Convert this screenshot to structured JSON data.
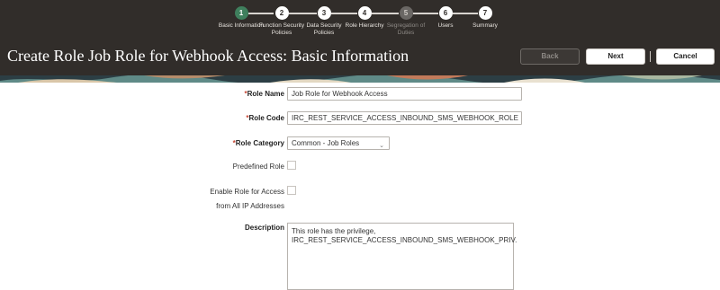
{
  "train": {
    "steps": [
      {
        "num": "1",
        "label": "Basic Information",
        "state": "current"
      },
      {
        "num": "2",
        "label": "Function Security Policies",
        "state": "normal"
      },
      {
        "num": "3",
        "label": "Data Security Policies",
        "state": "normal"
      },
      {
        "num": "4",
        "label": "Role Hierarchy",
        "state": "normal"
      },
      {
        "num": "5",
        "label": "Segregation of Duties",
        "state": "disabled"
      },
      {
        "num": "6",
        "label": "Users",
        "state": "normal"
      },
      {
        "num": "7",
        "label": "Summary",
        "state": "normal"
      }
    ]
  },
  "header": {
    "title": "Create Role Job Role for Webhook Access: Basic Information",
    "back_label": "Back",
    "next_label": "Next",
    "cancel_label": "Cancel"
  },
  "form": {
    "required_marker": "*",
    "role_name": {
      "label": "Role Name",
      "value": "Job Role for Webhook Access"
    },
    "role_code": {
      "label": "Role Code",
      "value": "IRC_REST_SERVICE_ACCESS_INBOUND_SMS_WEBHOOK_ROLE"
    },
    "role_category": {
      "label": "Role Category",
      "value": "Common - Job Roles"
    },
    "predefined_role": {
      "label": "Predefined Role",
      "checked": false
    },
    "enable_role_access": {
      "label_line1": "Enable Role for Access",
      "label_line2": "from All IP Addresses",
      "checked": false
    },
    "description": {
      "label": "Description",
      "line1": "This role has the privilege,",
      "line2": "IRC_REST_SERVICE_ACCESS_INBOUND_SMS_WEBHOOK_PRIV."
    }
  },
  "colors": {
    "header_bg": "#312d2a",
    "current_step": "#3f7f5d",
    "required": "#c74634"
  }
}
